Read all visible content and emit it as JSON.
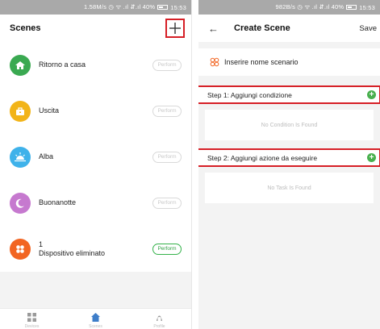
{
  "left_screen": {
    "status": "1.58M/s ◷ ᯤ .ıl ⇵.ıl 40%",
    "status_time": "15:53",
    "title": "Scenes",
    "scenes": [
      {
        "name": "Ritorno a casa",
        "perform": "Perform",
        "icon": "home-icon",
        "color": "#3aa951"
      },
      {
        "name": "Uscita",
        "perform": "Perform",
        "icon": "briefcase-icon",
        "color": "#f2b418"
      },
      {
        "name": "Alba",
        "perform": "Perform",
        "icon": "sunrise-icon",
        "color": "#3fb2ea"
      },
      {
        "name": "Buonanotte",
        "perform": "Perform",
        "icon": "moon-icon",
        "color": "#c679cf"
      },
      {
        "name_line1": "1",
        "name_line2": "Dispositivo eliminato",
        "perform": "Perform",
        "icon": "device-grid-icon",
        "color": "#f26522"
      }
    ],
    "tabs": [
      {
        "label": "Devices",
        "icon": "grid-icon"
      },
      {
        "label": "Scenes",
        "icon": "home-icon"
      },
      {
        "label": "Profile",
        "icon": "user-icon"
      }
    ]
  },
  "right_screen": {
    "status": "982B/s ◷ ᯤ .ıl ⇵.ıl 40%",
    "status_time": "15:53",
    "back": "←",
    "title": "Create Scene",
    "save": "Save",
    "name_placeholder": "Inserire nome scenario",
    "step1": "Step 1: Aggiungi condizione",
    "step1_empty": "No Condition Is Found",
    "step2": "Step 2: Aggiungi azione da eseguire",
    "step2_empty": "No Task Is Found"
  },
  "colors": {
    "accent_green": "#34b24a",
    "highlight_red": "#d61f26"
  }
}
